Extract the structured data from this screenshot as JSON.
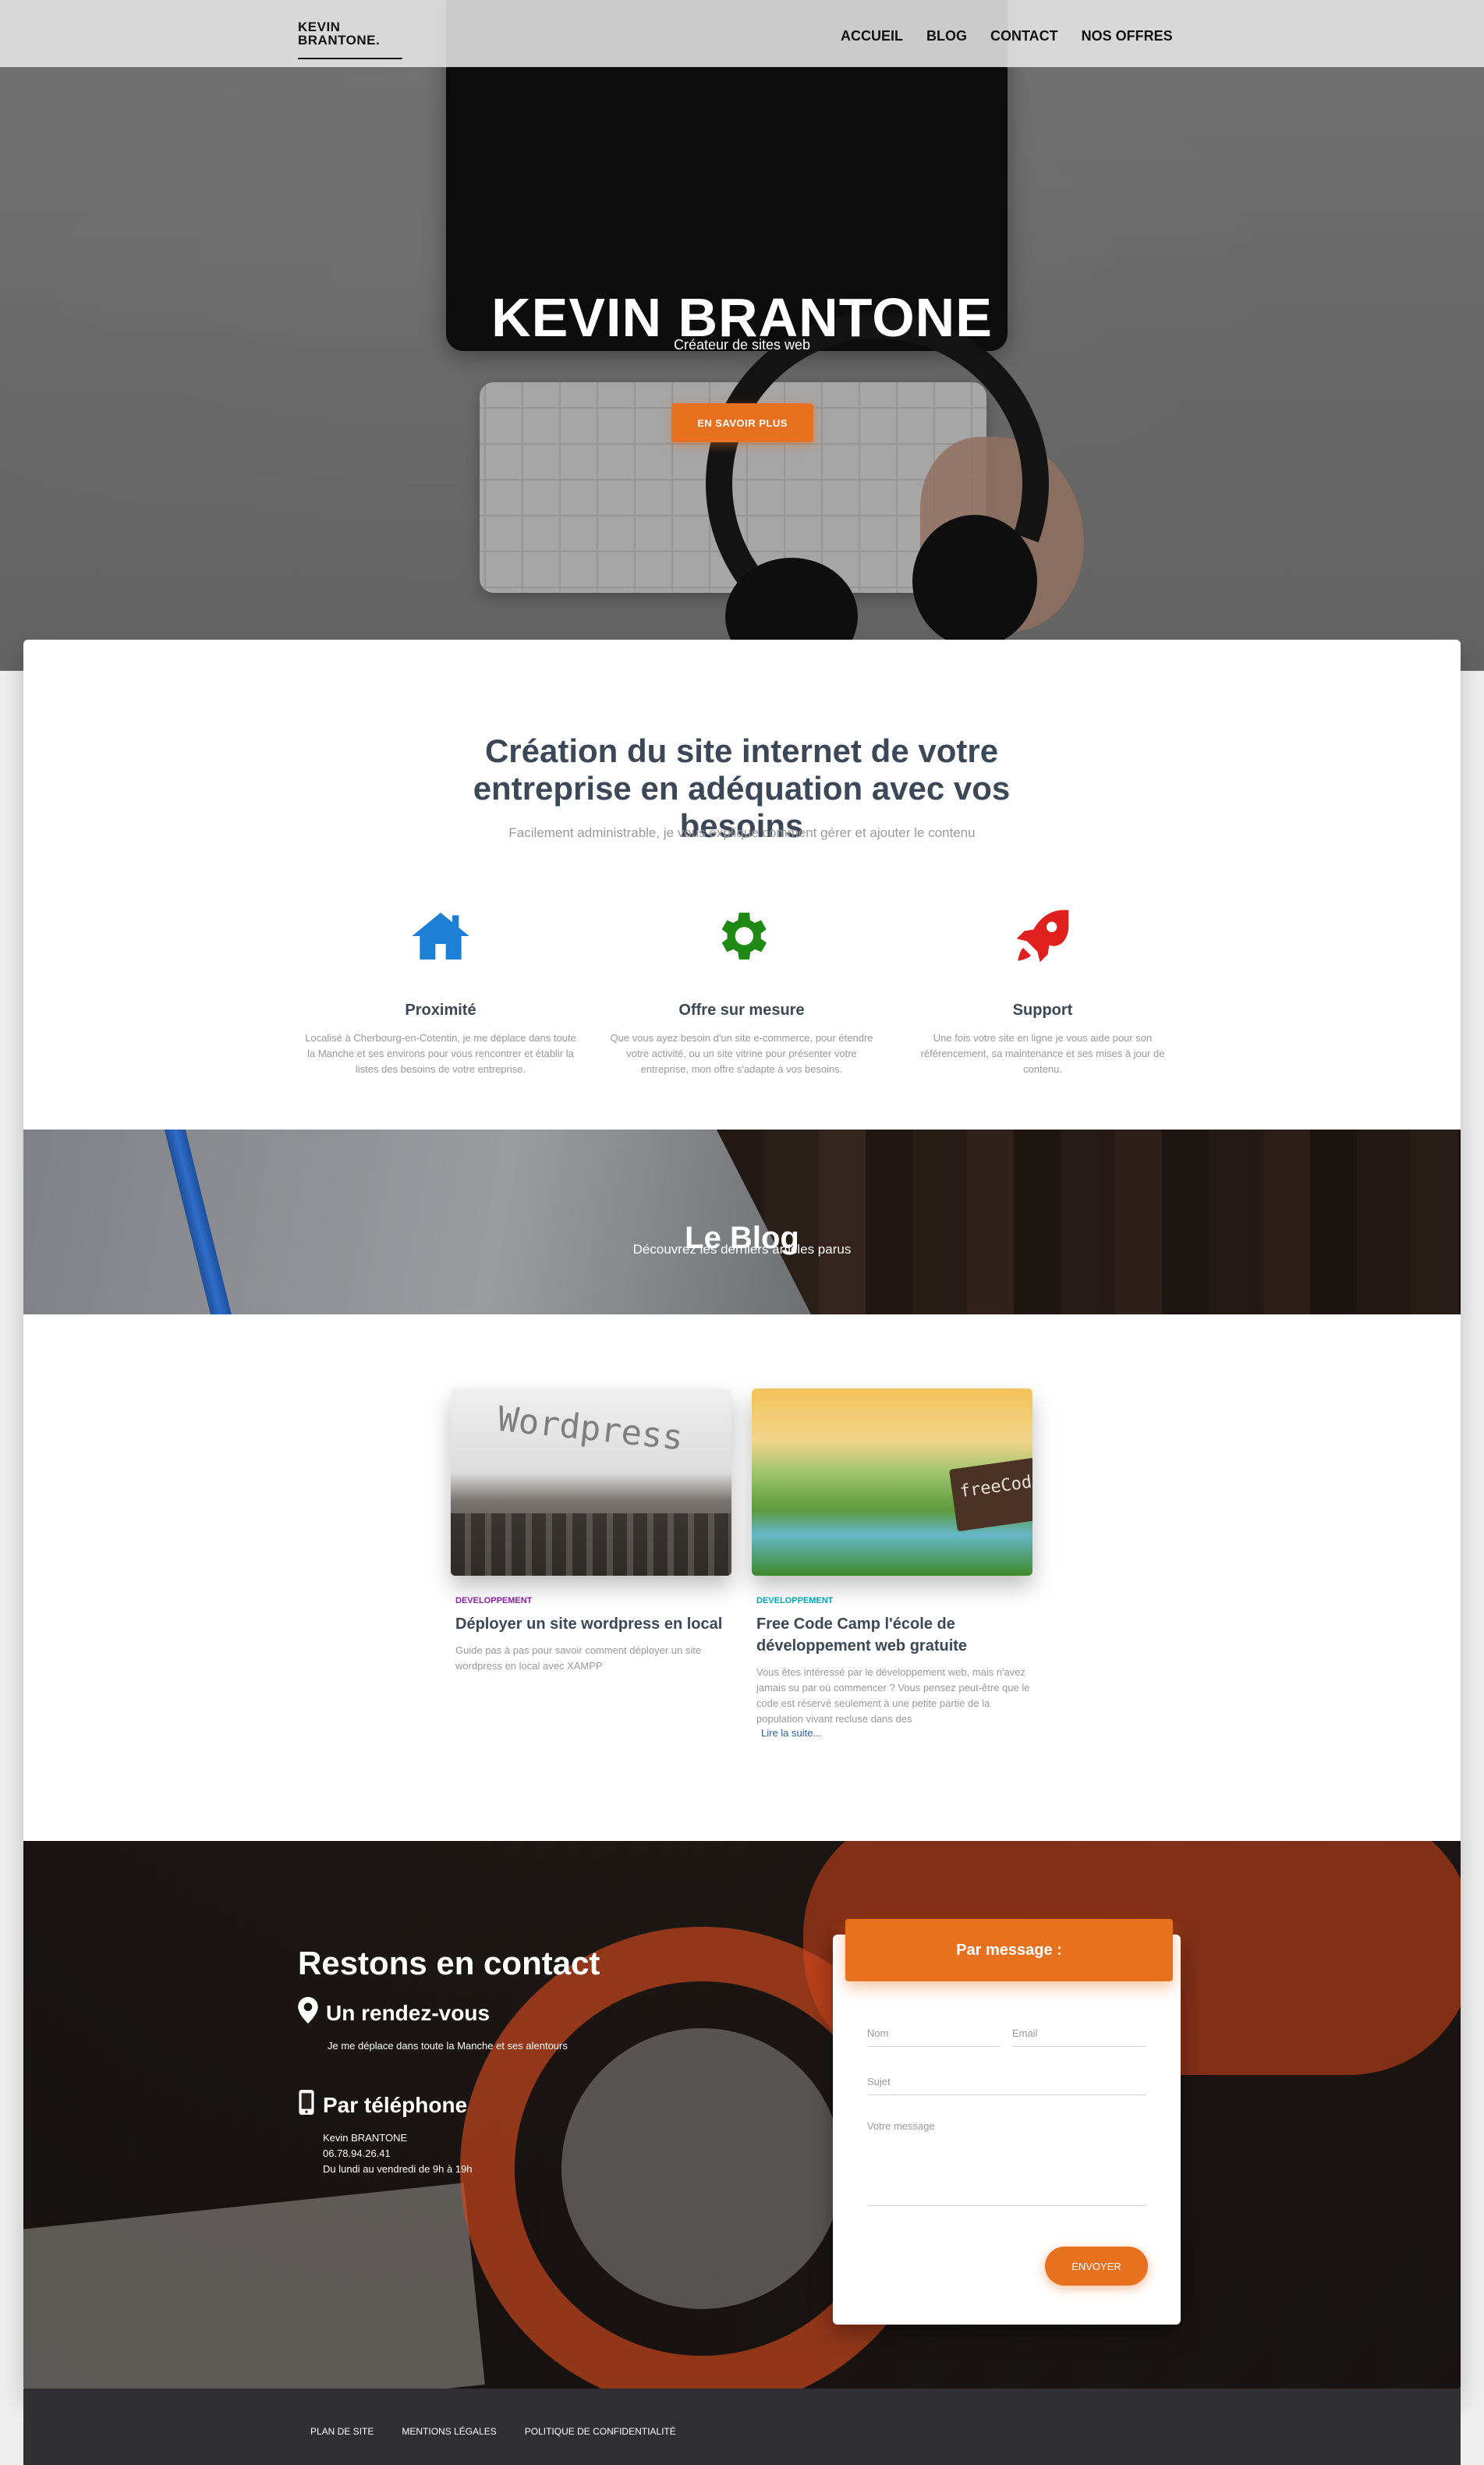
{
  "nav": {
    "logo_line1": "KEVIN",
    "logo_line2": "BRANTONE.",
    "links": [
      "ACCUEIL",
      "BLOG",
      "CONTACT",
      "NOS OFFRES"
    ]
  },
  "hero": {
    "title": "KEVIN BRANTONE",
    "subtitle": "Créateur de sites web",
    "button": "EN SAVOIR PLUS"
  },
  "intro": {
    "title": "Création du site internet de votre entreprise en adéquation avec vos besoins",
    "subtitle": "Facilement administrable, je vous explique comment gérer et ajouter le contenu"
  },
  "features": [
    {
      "icon": "home-icon",
      "color": "#1e7fd6",
      "title": "Proximité",
      "text": "Localisé à Cherbourg-en-Cotentin, je me déplace dans toute la Manche et ses environs pour vous rencontrer et établir la listes des besoins de votre entreprise."
    },
    {
      "icon": "gear-icon",
      "color": "#1e8a13",
      "title": "Offre sur mesure",
      "text": "Que vous ayez besoin d'un site e-commerce, pour étendre votre activité, ou un site vitrine pour présenter votre entreprise, mon offre s'adapte à vos besoins."
    },
    {
      "icon": "rocket-icon",
      "color": "#e0201e",
      "title": "Support",
      "text": "Une fois votre site en ligne je vous aide pour son référencement, sa maintenance et ses mises à jour de contenu."
    }
  ],
  "blog": {
    "title": "Le Blog",
    "subtitle": "Découvrez les derniers articles parus",
    "posts": [
      {
        "category": "DEVELOPPEMENT",
        "category_color": "#8e24aa",
        "image_text": "Wordpress",
        "title": "Déployer un site wordpress en local",
        "desc": "Guide pas à pas pour savoir comment déployer un site wordpress en local avec XAMPP",
        "more": ""
      },
      {
        "category": "DEVELOPPEMENT",
        "category_color": "#00acc1",
        "image_text": "freeCode",
        "title": "Free Code Camp l'école de développement web gratuite",
        "desc": "Vous êtes intéressé par le développement web, mais n'avez jamais su par où commencer ? Vous pensez peut-être que le code est réservé seulement à une petite partie de la population vivant recluse dans des",
        "more": "Lire la suite..."
      }
    ]
  },
  "contact": {
    "title": "Restons en contact",
    "meeting_title": "Un rendez-vous",
    "meeting_text": "Je me déplace dans toute la Manche et ses alentours",
    "phone_title": "Par téléphone",
    "phone_name": "Kevin BRANTONE",
    "phone_number": "06.78.94.26.41",
    "phone_hours": "Du lundi au vendredi de 9h à 19h",
    "form": {
      "header": "Par message :",
      "name_placeholder": "Nom",
      "email_placeholder": "Email",
      "subject_placeholder": "Sujet",
      "message_placeholder": "Votre message",
      "submit": "ENVOYER"
    }
  },
  "footer": {
    "links": [
      "PLAN DE SITE",
      "MENTIONS LÉGALES",
      "POLITIQUE DE CONFIDENTIALITÉ"
    ]
  }
}
